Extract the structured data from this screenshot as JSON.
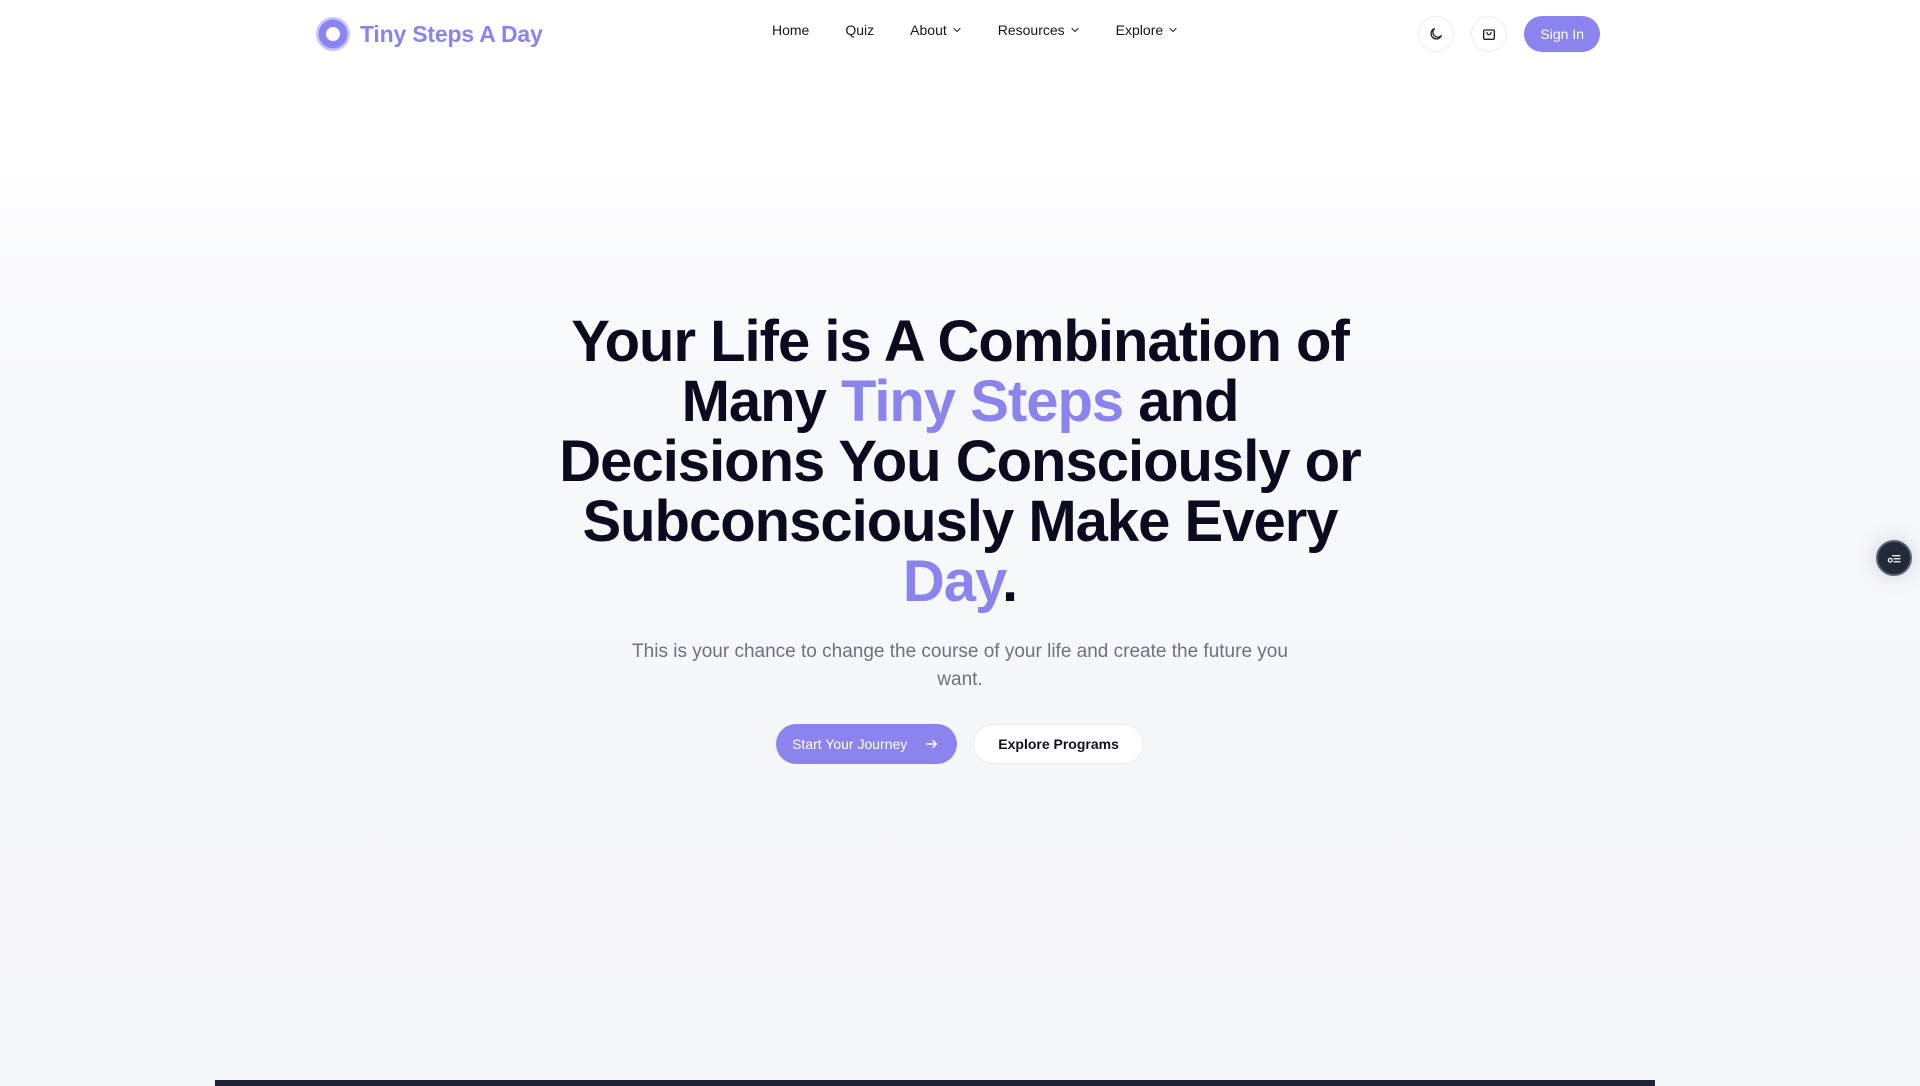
{
  "brand": {
    "name": "Tiny Steps A Day",
    "logo_icon": "sun-logo-icon",
    "accent_color": "#8b84ee"
  },
  "nav": {
    "items": [
      {
        "label": "Home",
        "has_dropdown": false
      },
      {
        "label": "Quiz",
        "has_dropdown": false
      },
      {
        "label": "About",
        "has_dropdown": true
      },
      {
        "label": "Resources",
        "has_dropdown": true
      },
      {
        "label": "Explore",
        "has_dropdown": true
      }
    ]
  },
  "header_actions": {
    "theme_toggle_icon": "moon-icon",
    "cart_icon": "shopping-bag-icon",
    "signin_label": "Sign In"
  },
  "hero": {
    "title_part1": "Your Life is A Combination of Many ",
    "title_accent1": "Tiny Steps",
    "title_part2": " and Decisions You Consciously or Subconsciously Make Every ",
    "title_accent2": "Day",
    "title_part3": ".",
    "subtitle": "This is your chance to change the course of your life and create the future you want.",
    "primary_cta": "Start Your Journey",
    "primary_cta_icon": "arrow-right-icon",
    "secondary_cta": "Explore Programs"
  },
  "side_fab": {
    "icon": "settings-list-icon"
  },
  "colors": {
    "text_dark": "#0b0b1f",
    "text_muted": "#6b7280",
    "primary": "#8b84ee",
    "fab_bg": "#222a3a"
  }
}
